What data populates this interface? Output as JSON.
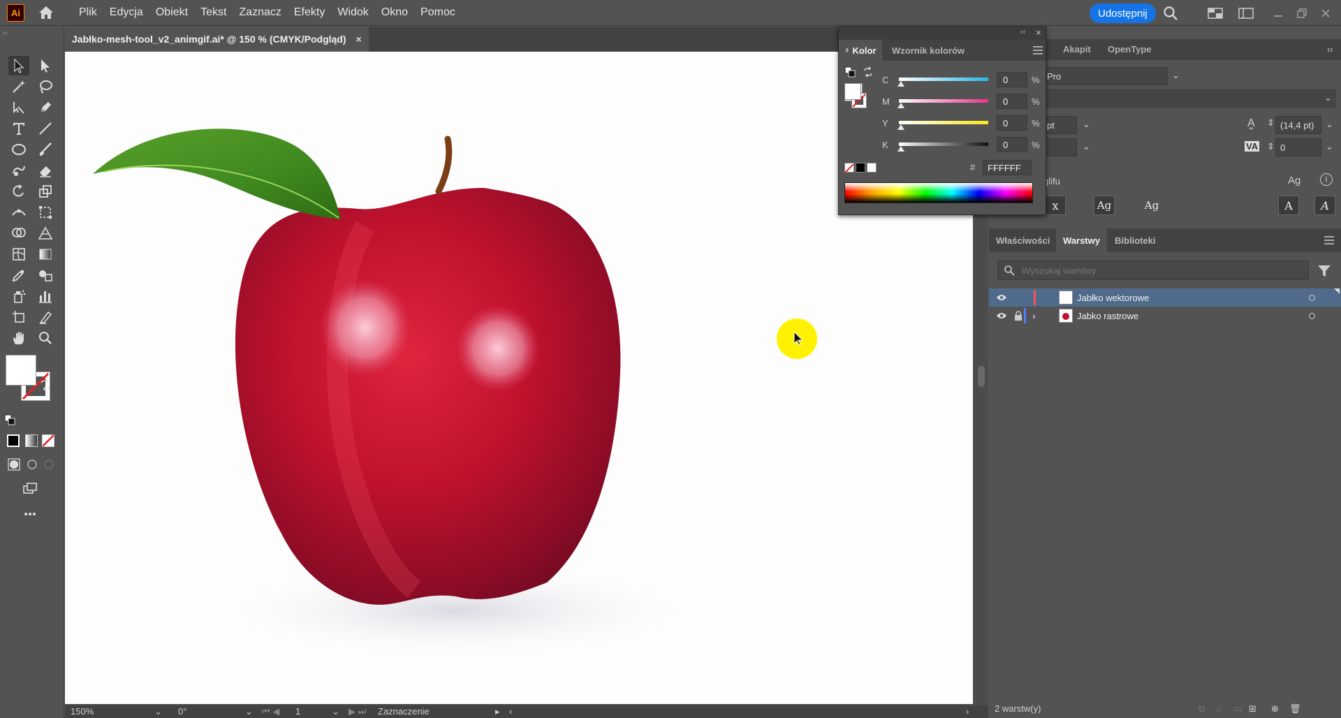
{
  "app": {
    "logo": "Ai"
  },
  "menu": [
    "Plik",
    "Edycja",
    "Obiekt",
    "Tekst",
    "Zaznacz",
    "Efekty",
    "Widok",
    "Okno",
    "Pomoc"
  ],
  "share_label": "Udostępnij",
  "document": {
    "tab_title": "Jabłko-mesh-tool_v2_animgif.ai* @ 150 % (CMYK/Podgląd)",
    "close": "×"
  },
  "status": {
    "zoom": "150%",
    "rotation": "0°",
    "artboard": "1",
    "tool": "Zaznaczenie"
  },
  "color_panel": {
    "tabs": [
      "Kolor",
      "Wzornik kolorów"
    ],
    "channels": [
      {
        "name": "C",
        "value": "0"
      },
      {
        "name": "M",
        "value": "0"
      },
      {
        "name": "Y",
        "value": "0"
      },
      {
        "name": "K",
        "value": "0"
      }
    ],
    "percent": "%",
    "hash": "#",
    "hex": "FFFFFF",
    "colors": {
      "cyan": "#29b6e8",
      "magenta": "#e8338f",
      "yellow": "#f5e617",
      "black": "#111111"
    }
  },
  "character_panel": {
    "tabs": [
      "Akapit",
      "OpenType"
    ],
    "font_family": "Pro",
    "size_suffix": "pt",
    "leading": "(14,4 pt)",
    "tracking": "0",
    "glyph_label": "glifu"
  },
  "layers_panel": {
    "tabs": [
      "Właściwości",
      "Warstwy",
      "Biblioteki"
    ],
    "search_placeholder": "Wyszukaj warstwy",
    "layers": [
      {
        "name": "Jabłko wektorowe",
        "color": "#ff4f4f",
        "selected": true,
        "locked": false
      },
      {
        "name": "Jabko rastrowe",
        "color": "#4f80ff",
        "selected": false,
        "locked": true
      }
    ],
    "footer": "2 warstw(y)"
  }
}
